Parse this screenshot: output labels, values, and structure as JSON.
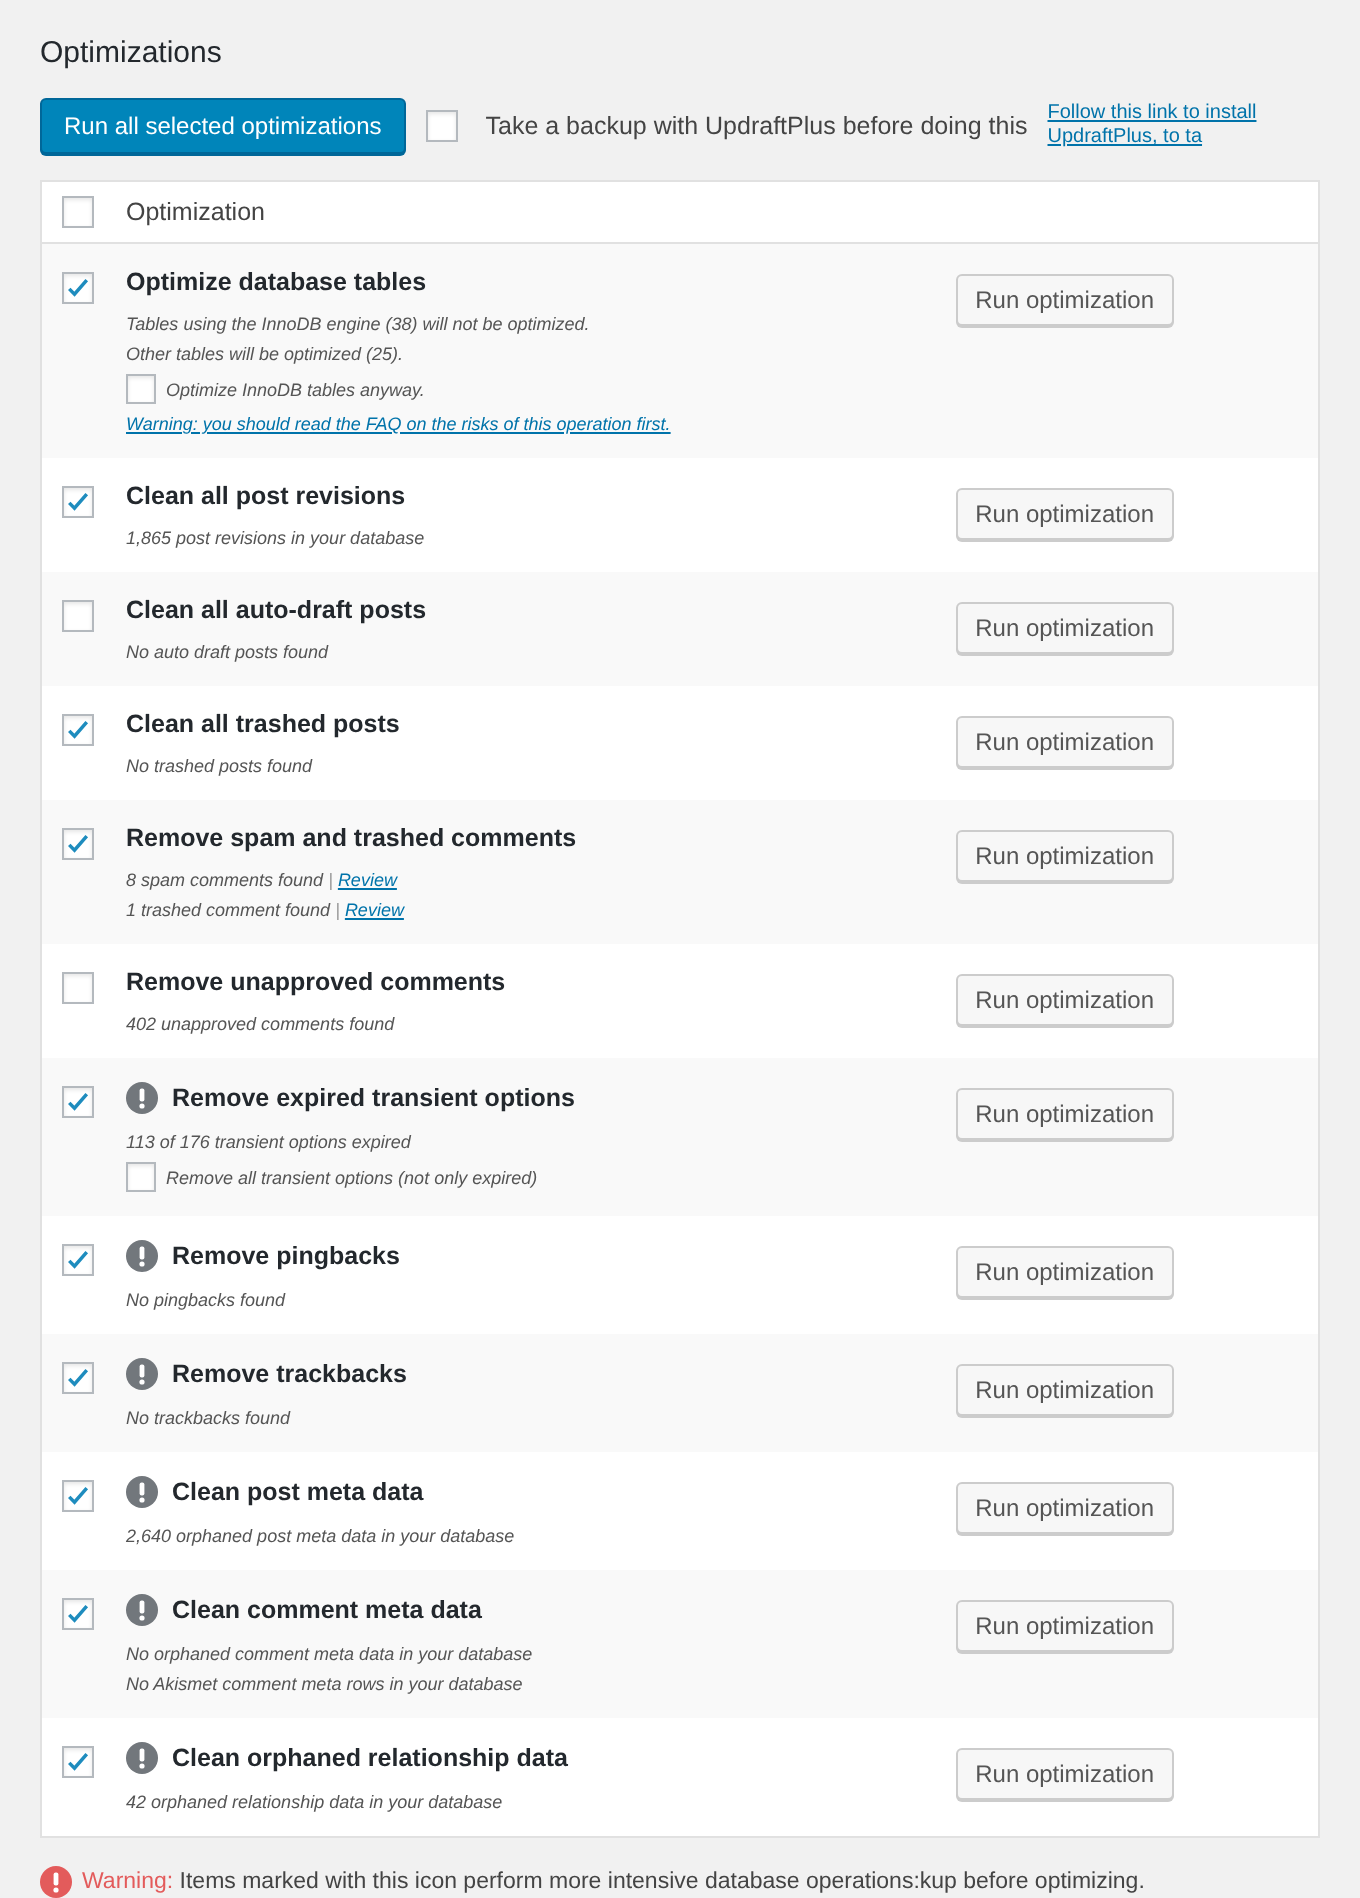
{
  "title": "Optimizations",
  "run_all_button": "Run all selected optimizations",
  "backup": {
    "checked": false,
    "label": "Take a backup with UpdraftPlus before doing this",
    "link": "Follow this link to install UpdraftPlus, to ta"
  },
  "table": {
    "header": {
      "checked": false,
      "label": "Optimization"
    },
    "rows": [
      {
        "checked": true,
        "intensive": false,
        "title": "Optimize database tables",
        "button": "Run optimization",
        "details": [
          {
            "kind": "note",
            "text": "Tables using the InnoDB engine (38) will not be optimized."
          },
          {
            "kind": "note",
            "text": "Other tables will be optimized (25)."
          },
          {
            "kind": "option",
            "checked": false,
            "label": "Optimize InnoDB tables anyway."
          },
          {
            "kind": "link",
            "text": "Warning: you should read the FAQ on the risks of this operation first."
          }
        ]
      },
      {
        "checked": true,
        "intensive": false,
        "title": "Clean all post revisions",
        "button": "Run optimization",
        "details": [
          {
            "kind": "note",
            "text": "1,865 post revisions in your database"
          }
        ]
      },
      {
        "checked": false,
        "intensive": false,
        "title": "Clean all auto-draft posts",
        "button": "Run optimization",
        "details": [
          {
            "kind": "note",
            "text": "No auto draft posts found"
          }
        ]
      },
      {
        "checked": true,
        "intensive": false,
        "title": "Clean all trashed posts",
        "button": "Run optimization",
        "details": [
          {
            "kind": "note",
            "text": "No trashed posts found"
          }
        ]
      },
      {
        "checked": true,
        "intensive": false,
        "title": "Remove spam and trashed comments",
        "button": "Run optimization",
        "details": [
          {
            "kind": "note-link",
            "text": "8 spam comments found",
            "separator": "|",
            "link": "Review"
          },
          {
            "kind": "note-link",
            "text": "1 trashed comment found",
            "separator": "|",
            "link": "Review"
          }
        ]
      },
      {
        "checked": false,
        "intensive": false,
        "title": "Remove unapproved comments",
        "button": "Run optimization",
        "details": [
          {
            "kind": "note",
            "text": "402 unapproved comments found"
          }
        ]
      },
      {
        "checked": true,
        "intensive": true,
        "title": "Remove expired transient options",
        "button": "Run optimization",
        "details": [
          {
            "kind": "note",
            "text": "113 of 176 transient options expired"
          },
          {
            "kind": "option",
            "checked": false,
            "label": "Remove all transient options (not only expired)"
          }
        ]
      },
      {
        "checked": true,
        "intensive": true,
        "title": "Remove pingbacks",
        "button": "Run optimization",
        "details": [
          {
            "kind": "note",
            "text": "No pingbacks found"
          }
        ]
      },
      {
        "checked": true,
        "intensive": true,
        "title": "Remove trackbacks",
        "button": "Run optimization",
        "details": [
          {
            "kind": "note",
            "text": "No trackbacks found"
          }
        ]
      },
      {
        "checked": true,
        "intensive": true,
        "title": "Clean post meta data",
        "button": "Run optimization",
        "details": [
          {
            "kind": "note",
            "text": "2,640 orphaned post meta data in your database"
          }
        ]
      },
      {
        "checked": true,
        "intensive": true,
        "title": "Clean comment meta data",
        "button": "Run optimization",
        "details": [
          {
            "kind": "note",
            "text": "No orphaned comment meta data in your database"
          },
          {
            "kind": "note",
            "text": "No Akismet comment meta rows in your database"
          }
        ]
      },
      {
        "checked": true,
        "intensive": true,
        "title": "Clean orphaned relationship data",
        "button": "Run optimization",
        "details": [
          {
            "kind": "note",
            "text": "42 orphaned relationship data in your database"
          }
        ]
      }
    ]
  },
  "footer": {
    "label": "Warning:",
    "text": "Items marked with this icon perform more intensive database operations:kup before optimizing."
  }
}
